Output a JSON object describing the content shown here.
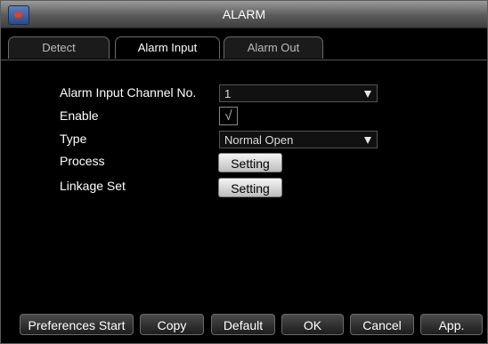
{
  "window": {
    "title": "ALARM",
    "app_icon": "camera-app-icon"
  },
  "tabs": [
    {
      "label": "Detect",
      "active": false
    },
    {
      "label": "Alarm Input",
      "active": true
    },
    {
      "label": "Alarm Out",
      "active": false
    }
  ],
  "form": {
    "channel_label": "Alarm Input Channel No.",
    "channel_value": "1",
    "enable_label": "Enable",
    "enable_checked": true,
    "enable_mark": "√",
    "type_label": "Type",
    "type_value": "Normal Open",
    "process_label": "Process",
    "process_button": "Setting",
    "linkage_label": "Linkage Set",
    "linkage_button": "Setting"
  },
  "footer": {
    "preferences_start": "Preferences Start",
    "copy": "Copy",
    "default": "Default",
    "ok": "OK",
    "cancel": "Cancel",
    "apply": "App."
  }
}
